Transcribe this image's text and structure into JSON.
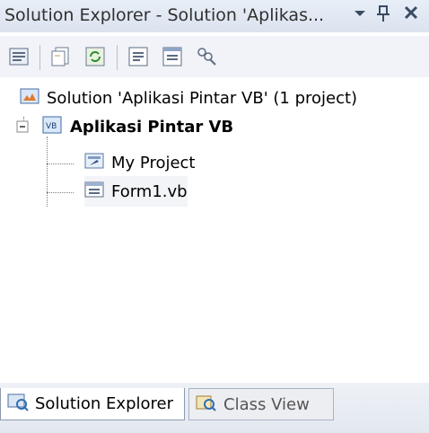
{
  "window": {
    "title": "Solution Explorer - Solution 'Aplikas...",
    "dropdown_icon": "chevron-down-icon",
    "pin_icon": "pin-icon",
    "close_icon": "close-icon"
  },
  "toolbar": {
    "buttons": [
      {
        "name": "properties-icon"
      },
      {
        "name": "show-all-files-icon"
      },
      {
        "name": "refresh-icon"
      },
      {
        "name": "view-code-icon"
      },
      {
        "name": "view-designer-icon"
      },
      {
        "name": "class-view-icon"
      }
    ]
  },
  "tree": {
    "solution": "Solution 'Aplikasi Pintar VB' (1 project)",
    "project": "Aplikasi Pintar VB",
    "expander": "-",
    "items": [
      {
        "label": "My Project"
      },
      {
        "label": "Form1.vb"
      }
    ]
  },
  "tabs": [
    {
      "label": "Solution Explorer",
      "active": true
    },
    {
      "label": "Class View",
      "active": false
    }
  ],
  "colors": {
    "titlebar": "#dbe3ef",
    "toolbar": "#f1f3f8",
    "accent": "#2f6fb3"
  }
}
